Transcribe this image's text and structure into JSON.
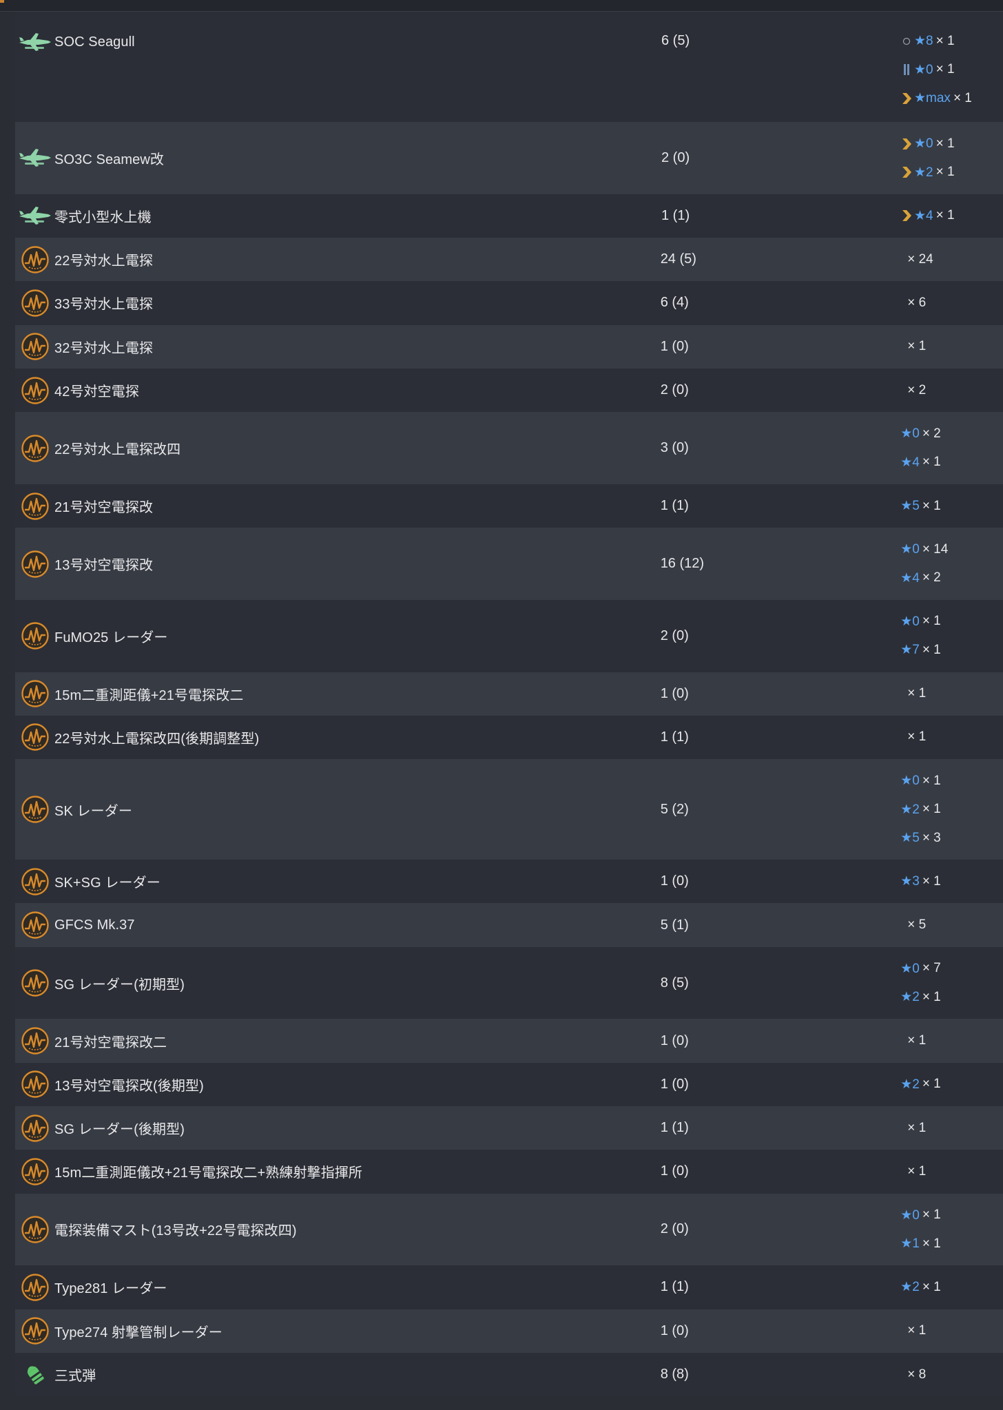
{
  "rows": [
    {
      "name": "SOC Seagull",
      "count": "6 (5)",
      "icon": "seaplane-icon",
      "levels": [
        {
          "prof": "ring",
          "star": "★8",
          "times": "× 1"
        },
        {
          "prof": "bars",
          "star": "★0",
          "times": "× 1"
        },
        {
          "prof": "chevron",
          "star": "★max",
          "times": "× 1"
        }
      ]
    },
    {
      "name": "SO3C Seamew改",
      "count": "2 (0)",
      "icon": "seaplane-icon",
      "levels": [
        {
          "prof": "chevron",
          "star": "★0",
          "times": "× 1"
        },
        {
          "prof": "chevron",
          "star": "★2",
          "times": "× 1"
        }
      ]
    },
    {
      "name": "零式小型水上機",
      "count": "1 (1)",
      "icon": "seaplane-icon",
      "levels": [
        {
          "prof": "chevron",
          "star": "★4",
          "times": "× 1"
        }
      ]
    },
    {
      "name": "22号対水上電探",
      "count": "24 (5)",
      "icon": "radar-icon",
      "levels": [
        {
          "star": "",
          "times": "× 24"
        }
      ]
    },
    {
      "name": "33号対水上電探",
      "count": "6 (4)",
      "icon": "radar-icon",
      "levels": [
        {
          "star": "",
          "times": "× 6"
        }
      ]
    },
    {
      "name": "32号対水上電探",
      "count": "1 (0)",
      "icon": "radar-icon",
      "levels": [
        {
          "star": "",
          "times": "× 1"
        }
      ]
    },
    {
      "name": "42号対空電探",
      "count": "2 (0)",
      "icon": "radar-icon",
      "levels": [
        {
          "star": "",
          "times": "× 2"
        }
      ]
    },
    {
      "name": "22号対水上電探改四",
      "count": "3 (0)",
      "icon": "radar-icon",
      "levels": [
        {
          "star": "★0",
          "times": "× 2"
        },
        {
          "star": "★4",
          "times": "× 1"
        }
      ]
    },
    {
      "name": "21号対空電探改",
      "count": "1 (1)",
      "icon": "radar-icon",
      "levels": [
        {
          "star": "★5",
          "times": "× 1"
        }
      ]
    },
    {
      "name": "13号対空電探改",
      "count": "16 (12)",
      "icon": "radar-icon",
      "levels": [
        {
          "star": "★0",
          "times": "× 14"
        },
        {
          "star": "★4",
          "times": "× 2"
        }
      ]
    },
    {
      "name": "FuMO25 レーダー",
      "count": "2 (0)",
      "icon": "radar-icon",
      "levels": [
        {
          "star": "★0",
          "times": "× 1"
        },
        {
          "star": "★7",
          "times": "× 1"
        }
      ]
    },
    {
      "name": "15m二重測距儀+21号電探改二",
      "count": "1 (0)",
      "icon": "radar-icon",
      "levels": [
        {
          "star": "",
          "times": "× 1"
        }
      ]
    },
    {
      "name": "22号対水上電探改四(後期調整型)",
      "count": "1 (1)",
      "icon": "radar-icon",
      "levels": [
        {
          "star": "",
          "times": "× 1"
        }
      ]
    },
    {
      "name": "SK レーダー",
      "count": "5 (2)",
      "icon": "radar-icon",
      "levels": [
        {
          "star": "★0",
          "times": "× 1"
        },
        {
          "star": "★2",
          "times": "× 1"
        },
        {
          "star": "★5",
          "times": "× 3"
        }
      ]
    },
    {
      "name": "SK+SG レーダー",
      "count": "1 (0)",
      "icon": "radar-icon",
      "levels": [
        {
          "star": "★3",
          "times": "× 1"
        }
      ]
    },
    {
      "name": "GFCS Mk.37",
      "count": "5 (1)",
      "icon": "radar-icon",
      "levels": [
        {
          "star": "",
          "times": "× 5"
        }
      ]
    },
    {
      "name": "SG レーダー(初期型)",
      "count": "8 (5)",
      "icon": "radar-icon",
      "levels": [
        {
          "star": "★0",
          "times": "× 7"
        },
        {
          "star": "★2",
          "times": "× 1"
        }
      ]
    },
    {
      "name": "21号対空電探改二",
      "count": "1 (0)",
      "icon": "radar-icon",
      "levels": [
        {
          "star": "",
          "times": "× 1"
        }
      ]
    },
    {
      "name": "13号対空電探改(後期型)",
      "count": "1 (0)",
      "icon": "radar-icon",
      "levels": [
        {
          "star": "★2",
          "times": "× 1"
        }
      ]
    },
    {
      "name": "SG レーダー(後期型)",
      "count": "1 (1)",
      "icon": "radar-icon",
      "levels": [
        {
          "star": "",
          "times": "× 1"
        }
      ]
    },
    {
      "name": "15m二重測距儀改+21号電探改二+熟練射撃指揮所",
      "count": "1 (0)",
      "icon": "radar-icon",
      "levels": [
        {
          "star": "",
          "times": "× 1"
        }
      ]
    },
    {
      "name": "電探装備マスト(13号改+22号電探改四)",
      "count": "2 (0)",
      "icon": "radar-icon",
      "levels": [
        {
          "star": "★0",
          "times": "× 1"
        },
        {
          "star": "★1",
          "times": "× 1"
        }
      ]
    },
    {
      "name": "Type281 レーダー",
      "count": "1 (1)",
      "icon": "radar-icon",
      "levels": [
        {
          "star": "★2",
          "times": "× 1"
        }
      ]
    },
    {
      "name": "Type274 射撃管制レーダー",
      "count": "1 (0)",
      "icon": "radar-icon",
      "levels": [
        {
          "star": "",
          "times": "× 1"
        }
      ]
    },
    {
      "name": "三式弾",
      "count": "8 (8)",
      "icon": "shell-icon",
      "levels": [
        {
          "star": "",
          "times": "× 8"
        }
      ]
    }
  ],
  "colors": {
    "star": "#5aa3f0",
    "radar": "#d98a2a",
    "seaplane": "#8fd4a8",
    "shell": "#5ec46a"
  }
}
